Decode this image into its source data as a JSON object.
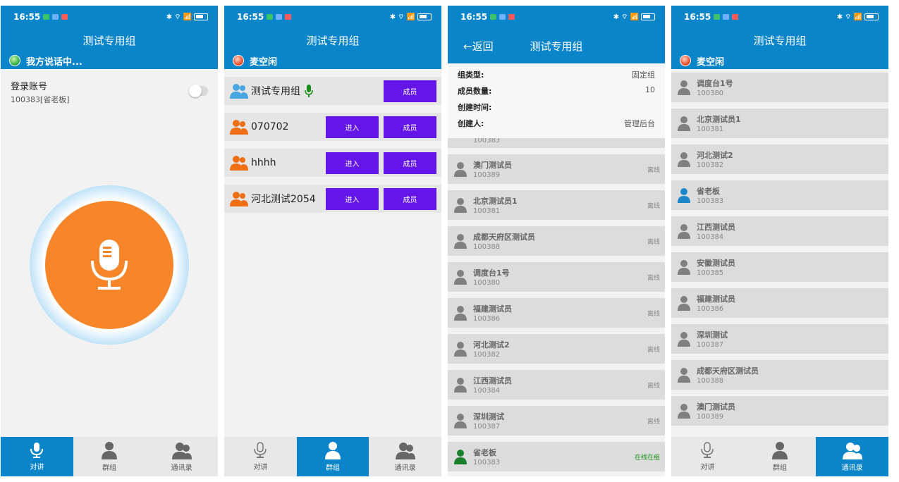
{
  "status_time": "16:55",
  "colors": {
    "primary": "#0a85c9",
    "ptt": "#f7852a",
    "button": "#6416e8",
    "online": "#1a8f1a",
    "person_gray": "#808080",
    "person_blue": "#1b86c8",
    "person_green": "#1a7f2a",
    "group_orange": "#ef6f16",
    "group_blue": "#4aa6e0"
  },
  "screen1": {
    "title": "测试专用组",
    "speaking_status": "我方说话中...",
    "login_label": "登录账号",
    "login_value": "100383[省老板]"
  },
  "screen2": {
    "title": "测试专用组",
    "mic_status": "麦空闲",
    "groups": [
      {
        "name": "测试专用组",
        "icon": "group-blue-icon",
        "active": true,
        "member_label": "成员"
      },
      {
        "name": "070702",
        "icon": "group-orange-icon",
        "enter_label": "进入",
        "member_label": "成员"
      },
      {
        "name": "hhhh",
        "icon": "group-orange-icon",
        "enter_label": "进入",
        "member_label": "成员"
      },
      {
        "name": "河北测试2054",
        "icon": "group-orange-icon",
        "enter_label": "进入",
        "member_label": "成员"
      }
    ]
  },
  "screen3": {
    "back_label": "←返回",
    "title": "测试专用组",
    "info": [
      {
        "key": "组类型:",
        "value": "固定组"
      },
      {
        "key": "成员数量:",
        "value": "10"
      },
      {
        "key": "创建时间:",
        "value": ""
      },
      {
        "key": "创建人:",
        "value": "管理后台"
      }
    ],
    "partial_id": "100383",
    "members": [
      {
        "name": "澳门测试员",
        "id": "100389",
        "state": "离线"
      },
      {
        "name": "北京测试员1",
        "id": "100381",
        "state": "离线"
      },
      {
        "name": "成都天府区测试员",
        "id": "100388",
        "state": "离线"
      },
      {
        "name": "调度台1号",
        "id": "100380",
        "state": "离线"
      },
      {
        "name": "福建测试员",
        "id": "100386",
        "state": "离线"
      },
      {
        "name": "河北测试2",
        "id": "100382",
        "state": "离线"
      },
      {
        "name": "江西测试员",
        "id": "100384",
        "state": "离线"
      },
      {
        "name": "深圳测试",
        "id": "100387",
        "state": "离线"
      },
      {
        "name": "省老板",
        "id": "100383",
        "state": "在线在组",
        "online": true
      }
    ]
  },
  "screen4": {
    "title": "测试专用组",
    "mic_status": "麦空闲",
    "contacts": [
      {
        "name": "调度台1号",
        "id": "100380"
      },
      {
        "name": "北京测试员1",
        "id": "100381"
      },
      {
        "name": "河北测试2",
        "id": "100382"
      },
      {
        "name": "省老板",
        "id": "100383",
        "self": true
      },
      {
        "name": "江西测试员",
        "id": "100384"
      },
      {
        "name": "安徽测试员",
        "id": "100385"
      },
      {
        "name": "福建测试员",
        "id": "100386"
      },
      {
        "name": "深圳测试",
        "id": "100387"
      },
      {
        "name": "成都天府区测试员",
        "id": "100388"
      },
      {
        "name": "澳门测试员",
        "id": "100389"
      }
    ]
  },
  "nav": {
    "talk": "对讲",
    "groups": "群组",
    "contacts": "通讯录"
  }
}
